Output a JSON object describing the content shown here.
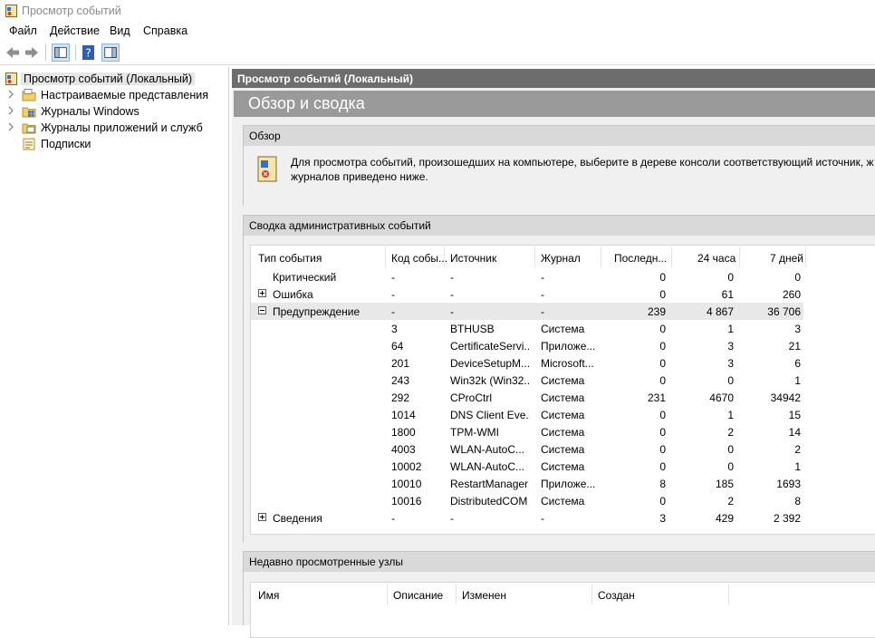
{
  "window": {
    "title": "Просмотр событий"
  },
  "menu": [
    "Файл",
    "Действие",
    "Вид",
    "Справка"
  ],
  "tree": [
    {
      "label": "Просмотр событий (Локальный)",
      "icon": "event-viewer-icon",
      "selected": true
    },
    {
      "label": "Настраиваемые представления",
      "icon": "folder-views-icon"
    },
    {
      "label": "Журналы Windows",
      "icon": "windows-logs-icon"
    },
    {
      "label": "Журналы приложений и служб",
      "icon": "app-logs-icon"
    },
    {
      "label": "Подписки",
      "icon": "subscriptions-icon"
    }
  ],
  "right": {
    "header": "Просмотр событий (Локальный)",
    "banner": "Обзор и сводка",
    "overview": {
      "title": "Обзор",
      "line1": "Для просмотра событий, произошедших на компьютере, выберите в дереве консоли соответствующий источник, ж",
      "line2": "журналов приведено ниже."
    },
    "summary": {
      "title": "Сводка административных событий",
      "columns": [
        "Тип события",
        "Код собы...",
        "Источник",
        "Журнал",
        "Последн...",
        "24 часа",
        "7 дней"
      ],
      "rows": [
        {
          "type": "Критический",
          "code": "-",
          "source": "-",
          "log": "-",
          "last": "0",
          "day": "0",
          "week": "0",
          "exp": ""
        },
        {
          "type": "Ошибка",
          "code": "-",
          "source": "-",
          "log": "-",
          "last": "0",
          "day": "61",
          "week": "260",
          "exp": "plus"
        },
        {
          "type": "Предупреждение",
          "code": "-",
          "source": "-",
          "log": "-",
          "last": "239",
          "day": "4 867",
          "week": "36 706",
          "exp": "minus",
          "hl": true
        },
        {
          "type": "",
          "code": "3",
          "source": "BTHUSB",
          "log": "Система",
          "last": "0",
          "day": "1",
          "week": "3"
        },
        {
          "type": "",
          "code": "64",
          "source": "CertificateServi...",
          "log": "Приложе...",
          "last": "0",
          "day": "3",
          "week": "21"
        },
        {
          "type": "",
          "code": "201",
          "source": "DeviceSetupM...",
          "log": "Microsoft...",
          "last": "0",
          "day": "3",
          "week": "6"
        },
        {
          "type": "",
          "code": "243",
          "source": "Win32k (Win32...",
          "log": "Система",
          "last": "0",
          "day": "0",
          "week": "1"
        },
        {
          "type": "",
          "code": "292",
          "source": "CProCtrl",
          "log": "Система",
          "last": "231",
          "day": "4670",
          "week": "34942"
        },
        {
          "type": "",
          "code": "1014",
          "source": "DNS Client Eve...",
          "log": "Система",
          "last": "0",
          "day": "1",
          "week": "15"
        },
        {
          "type": "",
          "code": "1800",
          "source": "TPM-WMI",
          "log": "Система",
          "last": "0",
          "day": "2",
          "week": "14"
        },
        {
          "type": "",
          "code": "4003",
          "source": "WLAN-AutoC...",
          "log": "Система",
          "last": "0",
          "day": "0",
          "week": "2"
        },
        {
          "type": "",
          "code": "10002",
          "source": "WLAN-AutoC...",
          "log": "Система",
          "last": "0",
          "day": "0",
          "week": "1"
        },
        {
          "type": "",
          "code": "10010",
          "source": "RestartManager",
          "log": "Приложе...",
          "last": "8",
          "day": "185",
          "week": "1693"
        },
        {
          "type": "",
          "code": "10016",
          "source": "DistributedCOM",
          "log": "Система",
          "last": "0",
          "day": "2",
          "week": "8"
        },
        {
          "type": "Сведения",
          "code": "-",
          "source": "-",
          "log": "-",
          "last": "3",
          "day": "429",
          "week": "2 392",
          "exp": "plus"
        }
      ]
    },
    "recent": {
      "title": "Недавно просмотренные узлы",
      "columns": [
        "Имя",
        "Описание",
        "Изменен",
        "Создан"
      ]
    }
  }
}
